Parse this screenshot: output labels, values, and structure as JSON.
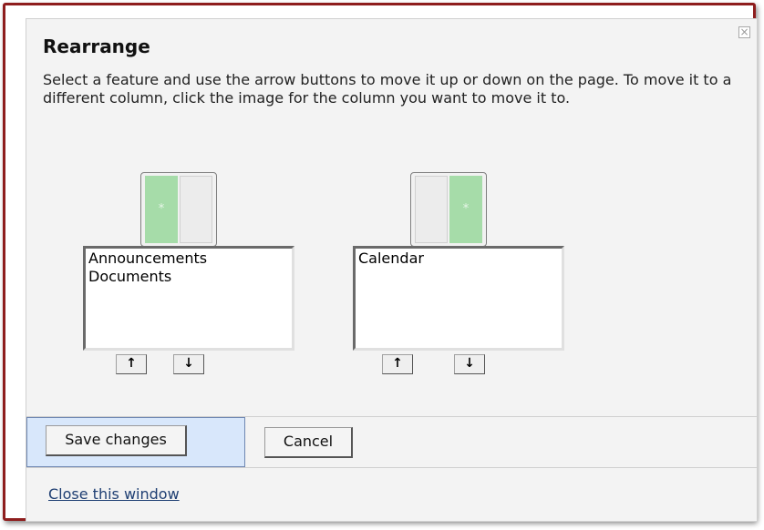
{
  "dialog": {
    "title": "Rearrange",
    "instructions": "Select a feature and use the arrow buttons to move it up or down on the page. To move it to a different column, click the image for the column you want to move it to.",
    "close_icon_glyph": "×"
  },
  "columns": [
    {
      "image_marker": "*",
      "items": [
        "Announcements",
        "Documents"
      ],
      "up_glyph": "🡅",
      "down_glyph": "🡇"
    },
    {
      "image_marker": "*",
      "items": [
        "Calendar"
      ],
      "up_glyph": "🡅",
      "down_glyph": "🡇"
    }
  ],
  "footer": {
    "save_label": "Save changes",
    "cancel_label": "Cancel",
    "close_link": "Close this window"
  },
  "colors": {
    "frame_border": "#8e1d1d",
    "selected_column_green": "#a6dca9",
    "save_highlight": "#d8e7fb",
    "link": "#1f3f73"
  }
}
